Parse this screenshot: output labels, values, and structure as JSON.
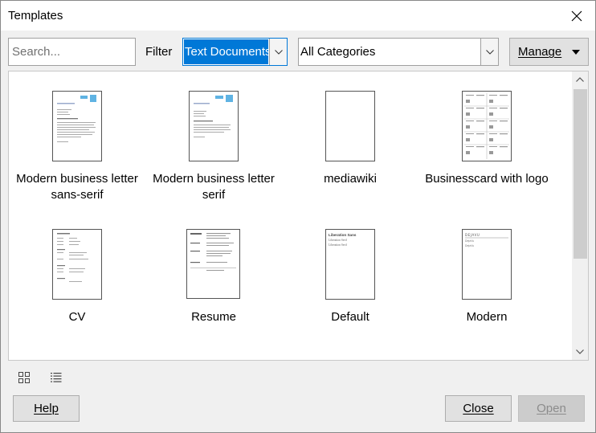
{
  "window": {
    "title": "Templates"
  },
  "toolbar": {
    "search_placeholder": "Search...",
    "filter_label": "Filter",
    "filter_value": "Text Documents",
    "category_value": "All Categories",
    "manage_label": "Manage"
  },
  "templates": [
    {
      "label": "Modern business letter sans-serif",
      "thumbnail": "business-letter-thumbnail"
    },
    {
      "label": "Modern business letter serif",
      "thumbnail": "business-letter-thumbnail"
    },
    {
      "label": "mediawiki",
      "thumbnail": "blank-page-thumbnail"
    },
    {
      "label": "Businesscard with logo",
      "thumbnail": "business-cards-thumbnail"
    },
    {
      "label": "CV",
      "thumbnail": "cv-thumbnail"
    },
    {
      "label": "Resume",
      "thumbnail": "resume-thumbnail"
    },
    {
      "label": "Default",
      "thumbnail": "default-thumbnail"
    },
    {
      "label": "Modern",
      "thumbnail": "modern-thumbnail"
    }
  ],
  "thumbnail_text": {
    "default_heading": "Liberation Sans",
    "default_line1": "Liberation Serif",
    "default_line2": "Liberation Serif",
    "modern_heading": "DEJAVU",
    "modern_line1": "DejaVu",
    "modern_line2": "DejaVu"
  },
  "view_toggles": {
    "thumbnail_icon": "grid-view-icon",
    "list_icon": "list-view-icon"
  },
  "footer": {
    "help_label": "Help",
    "close_label": "Close",
    "open_label": "Open"
  },
  "colors": {
    "accent": "#0078d7",
    "letter_accent": "#5fb3e3"
  }
}
